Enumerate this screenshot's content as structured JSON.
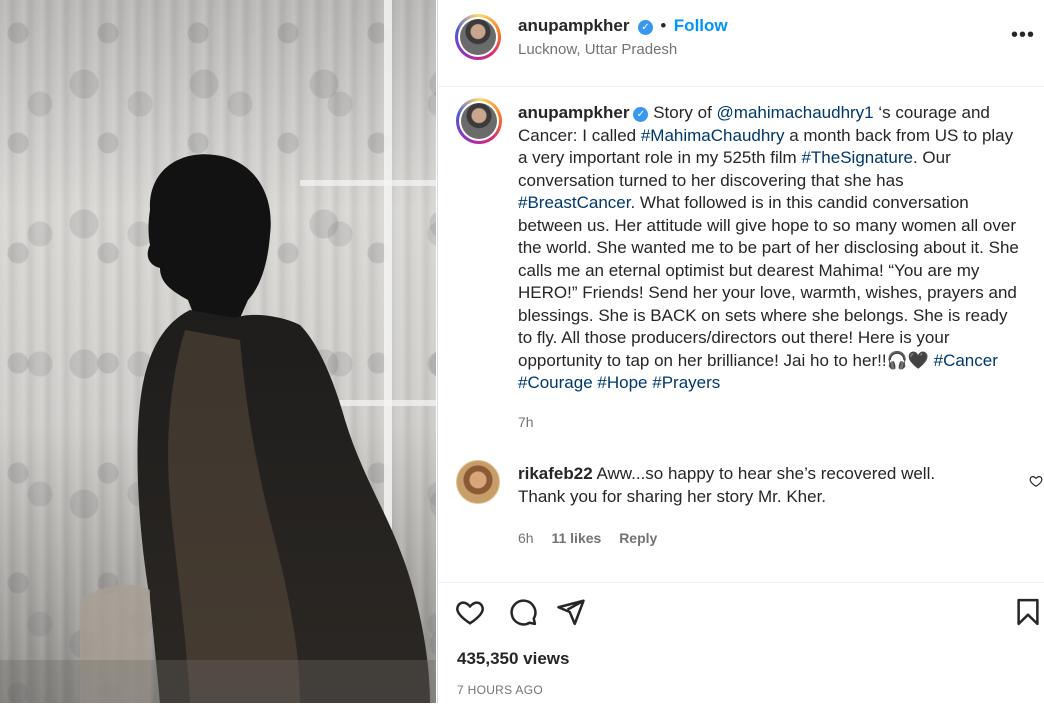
{
  "header": {
    "username": "anupampkher",
    "follow_label": "Follow",
    "location": "Lucknow, Uttar Pradesh",
    "more_icon": "more-options-icon"
  },
  "caption": {
    "username": "anupampkher",
    "segments": [
      {
        "t": "Story of "
      },
      {
        "t": "@mahimachaudhry1",
        "link": true
      },
      {
        "t": " ‘s courage and Cancer: I called "
      },
      {
        "t": "#MahimaChaudhry",
        "link": true
      },
      {
        "t": " a month back from US to play a very important role in my 525th film "
      },
      {
        "t": "#TheSignature",
        "link": true
      },
      {
        "t": ". Our conversation turned to her discovering that she has "
      },
      {
        "t": "#BreastCancer",
        "link": true
      },
      {
        "t": ". What followed is in this candid conversation between us. Her attitude will give hope to so many women all over the world. She wanted me to be part of her disclosing about it. She calls me an eternal optimist but dearest Mahima! “You are my HERO!” Friends! Send her your love, warmth, wishes, prayers and blessings. She is BACK on sets where she belongs. She is ready to fly. All those producers/directors out there! Here is your opportunity to tap on her brilliance! Jai ho to her!!🎧🖤 "
      },
      {
        "t": "#Cancer",
        "link": true
      },
      {
        "t": " "
      },
      {
        "t": "#Courage",
        "link": true
      },
      {
        "t": " "
      },
      {
        "t": "#Hope",
        "link": true
      },
      {
        "t": " "
      },
      {
        "t": "#Prayers",
        "link": true
      }
    ],
    "age": "7h"
  },
  "comment": {
    "username": "rikafeb22",
    "text": "Aww...so happy to hear she’s recovered well. Thank you for sharing her story Mr. Kher.",
    "age": "6h",
    "likes": "11 likes",
    "reply_label": "Reply"
  },
  "footer": {
    "views": "435,350 views",
    "timestamp": "7 HOURS AGO"
  },
  "icons": {
    "like": "heart-icon",
    "comment": "comment-icon",
    "share": "share-icon",
    "save": "bookmark-icon"
  }
}
